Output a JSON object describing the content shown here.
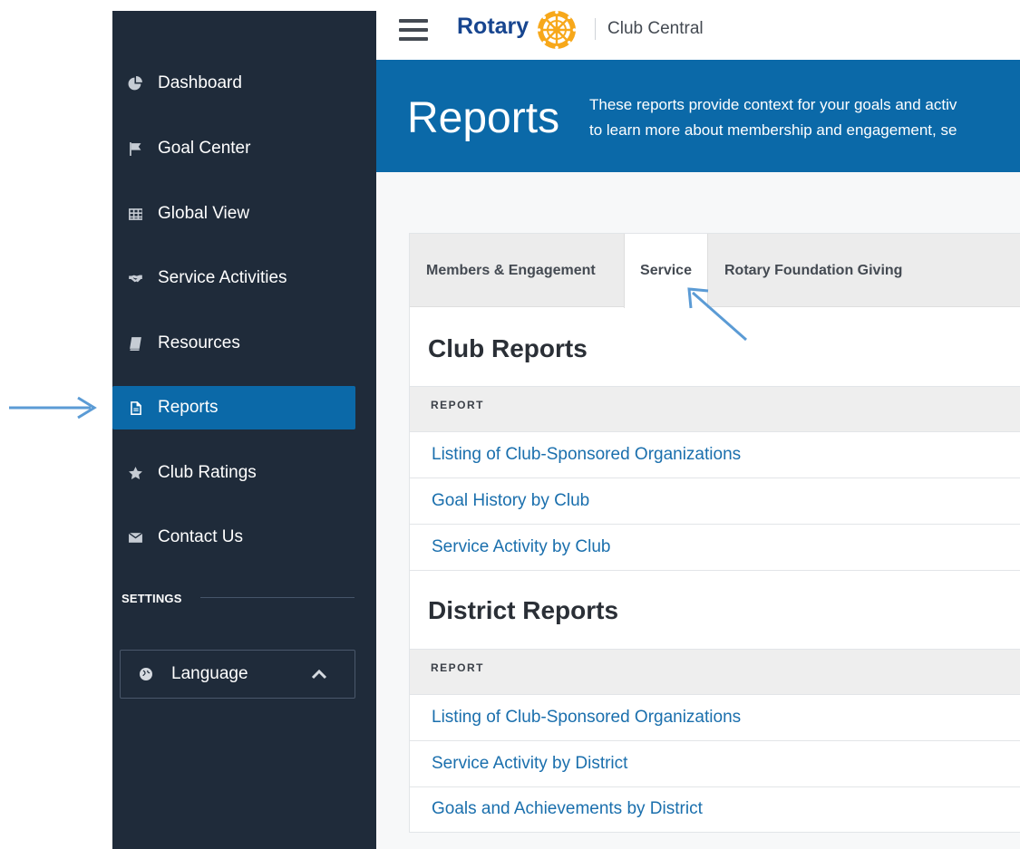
{
  "topbar": {
    "menu_icon": "hamburger-menu-icon",
    "brand": "Rotary",
    "logo_icon": "rotary-wheel-logo",
    "app_name": "Club Central"
  },
  "sidebar": {
    "items": [
      {
        "label": "Dashboard",
        "icon": "pie-chart-icon"
      },
      {
        "label": "Goal Center",
        "icon": "flag-icon"
      },
      {
        "label": "Global View",
        "icon": "grid-table-icon"
      },
      {
        "label": "Service Activities",
        "icon": "handshake-icon"
      },
      {
        "label": "Resources",
        "icon": "book-icon"
      },
      {
        "label": "Reports",
        "icon": "document-icon",
        "active": true
      },
      {
        "label": "Club Ratings",
        "icon": "star-icon"
      },
      {
        "label": "Contact Us",
        "icon": "envelope-icon"
      }
    ],
    "settings_label": "SETTINGS",
    "language": {
      "label": "Language",
      "icon": "globe-icon",
      "caret": "chevron-up-icon"
    }
  },
  "banner": {
    "title": "Reports",
    "text_line1": "These reports provide context for your goals and activ",
    "text_line2": "to learn more about membership and engagement, se"
  },
  "tabs": [
    {
      "label": "Members & Engagement",
      "active": false
    },
    {
      "label": "Service",
      "active": true
    },
    {
      "label": "Rotary Foundation Giving",
      "active": false
    }
  ],
  "club_reports": {
    "title": "Club Reports",
    "column": "REPORT",
    "rows": [
      "Listing of Club-Sponsored Organizations",
      "Goal History by Club",
      "Service Activity by Club"
    ]
  },
  "district_reports": {
    "title": "District Reports",
    "column": "REPORT",
    "rows": [
      "Listing of Club-Sponsored Organizations",
      "Service Activity by District",
      "Goals and Achievements by District"
    ]
  },
  "colors": {
    "sidebar_bg": "#1f2b3a",
    "accent_blue": "#0b69a8",
    "link_blue": "#1a6fad",
    "annotation_arrow": "#5b9bd5"
  }
}
